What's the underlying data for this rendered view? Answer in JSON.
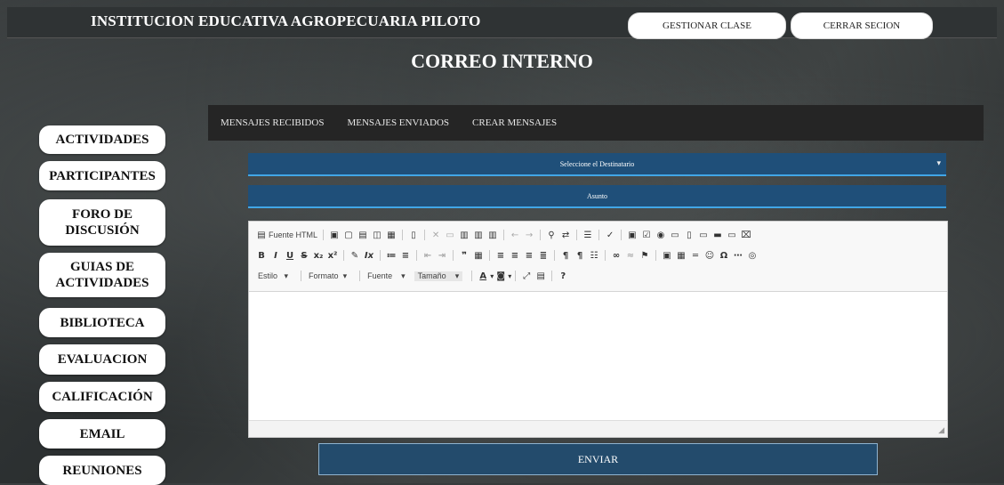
{
  "header": {
    "school_name": "INSTITUCION EDUCATIVA AGROPECUARIA PILOTO",
    "manage_class": "GESTIONAR CLASE",
    "logout": "CERRAR SECION"
  },
  "page_title": "CORREO INTERNO",
  "sidebar": {
    "items": [
      {
        "label": "ACTIVIDADES"
      },
      {
        "label": "PARTICIPANTES"
      },
      {
        "label": "FORO DE DISCUSIÓN"
      },
      {
        "label": "GUIAS DE ACTIVIDADES"
      },
      {
        "label": "BIBLIOTECA"
      },
      {
        "label": "EVALUACION"
      },
      {
        "label": "CALIFICACIÓN"
      },
      {
        "label": "EMAIL"
      },
      {
        "label": "REUNIONES"
      }
    ]
  },
  "mail_tabs": {
    "received": "MENSAJES RECIBIDOS",
    "sent": "MENSAJES ENVIADOS",
    "create": "CREAR MENSAJES"
  },
  "form": {
    "recipient_placeholder": "Seleccione el Destinatario",
    "subject_placeholder": "Asunto",
    "send_label": "ENVIAR"
  },
  "editor": {
    "source_label": "Fuente HTML",
    "style_combo": "Estilo",
    "format_combo": "Formato",
    "font_combo": "Fuente",
    "size_combo": "Tamaño"
  },
  "colors": {
    "field_bg": "#1f4f79",
    "field_border": "#41a6e6",
    "send_bg": "#234b6c"
  }
}
